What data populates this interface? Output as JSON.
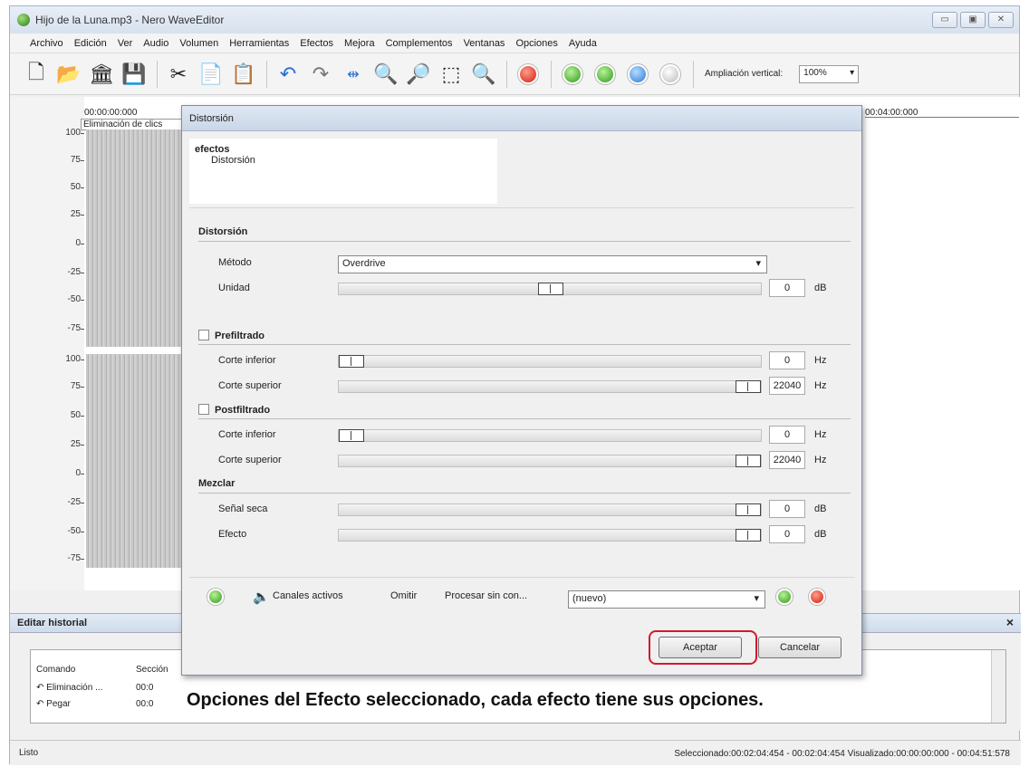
{
  "window": {
    "title": "Hijo de la Luna.mp3 - Nero WaveEditor",
    "controls": [
      "▭",
      "▣",
      "✕"
    ]
  },
  "menu": [
    "Archivo",
    "Edición",
    "Ver",
    "Audio",
    "Volumen",
    "Herramientas",
    "Efectos",
    "Mejora",
    "Complementos",
    "Ventanas",
    "Opciones",
    "Ayuda"
  ],
  "toolbar": {
    "zoom_label": "Ampliación vertical:",
    "zoom_value": "100%"
  },
  "waveform": {
    "time_start": "00:00:00:000",
    "time_end": "00:04:00:000",
    "clip_label": "Eliminación de clics",
    "axis_top": [
      "100",
      "75",
      "50",
      "25",
      "0",
      "-25",
      "-50",
      "-75"
    ],
    "axis_bottom": [
      "100",
      "75",
      "50",
      "25",
      "0",
      "-25",
      "-50",
      "-75"
    ]
  },
  "history": {
    "title": "Editar historial",
    "close": "×",
    "col_command": "Comando",
    "col_section": "Sección",
    "rows": [
      {
        "command": "↶ Eliminación ...",
        "section": "00:0"
      },
      {
        "command": "↶ Pegar",
        "section": "00:0"
      }
    ]
  },
  "status": {
    "left": "Listo",
    "right": "Seleccionado:00:02:04:454 - 00:02:04:454   Visualizado:00:00:00:000 - 00:04:51:578"
  },
  "dialog": {
    "title": "Distorsión",
    "tree_root": "efectos",
    "tree_child": "Distorsión",
    "sections": {
      "distorsion": "Distorsión",
      "prefiltrado": "Prefiltrado",
      "postfiltrado": "Postfiltrado",
      "mezclar": "Mezclar"
    },
    "method_label": "Método",
    "method_value": "Overdrive",
    "unidad_label": "Unidad",
    "unidad_value": "0",
    "unidad_unit": "dB",
    "pre_low_label": "Corte inferior",
    "pre_low_value": "0",
    "pre_low_unit": "Hz",
    "pre_high_label": "Corte superior",
    "pre_high_value": "22040",
    "pre_high_unit": "Hz",
    "post_low_label": "Corte inferior",
    "post_low_value": "0",
    "post_low_unit": "Hz",
    "post_high_label": "Corte superior",
    "post_high_value": "22040",
    "post_high_unit": "Hz",
    "seca_label": "Señal seca",
    "seca_value": "0",
    "seca_unit": "dB",
    "efecto_label": "Efecto",
    "efecto_value": "0",
    "efecto_unit": "dB",
    "footer": {
      "canales": "Canales activos",
      "omitir": "Omitir",
      "procesar": "Procesar sin con...",
      "preset": "(nuevo)"
    },
    "accept": "Aceptar",
    "cancel": "Cancelar"
  },
  "caption": "Opciones del Efecto seleccionado, cada efecto tiene sus opciones.",
  "colors": {
    "highlight_ring": "#d11a2a",
    "title_bar": "#d7e1ee"
  }
}
